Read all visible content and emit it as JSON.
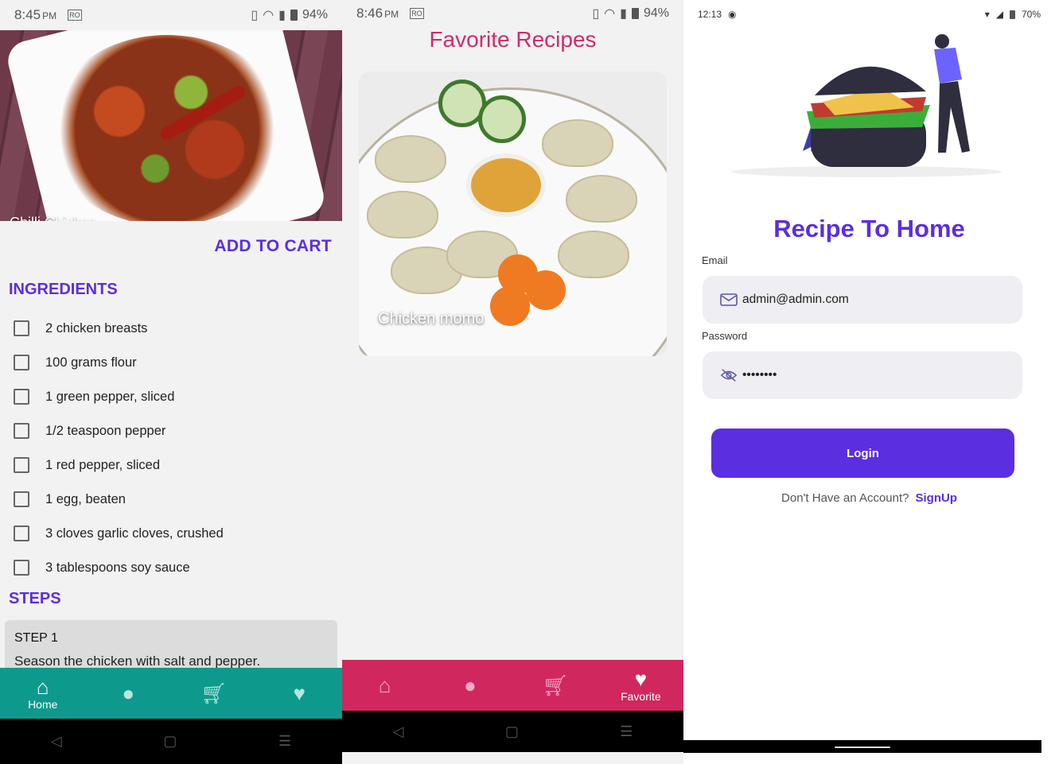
{
  "screen1": {
    "status": {
      "time": "8:45",
      "ampm": "PM",
      "badge": "RO",
      "battery": "94%"
    },
    "hero_title": "Chilli Chicken",
    "add_to_cart": "ADD TO CART",
    "ingredients_heading": "INGREDIENTS",
    "ingredients": [
      "2 chicken breasts",
      "100 grams flour",
      "1 green pepper, sliced",
      "1/2 teaspoon pepper",
      "1 red pepper, sliced",
      "1 egg, beaten",
      "3 cloves garlic cloves, crushed",
      "3 tablespoons soy sauce"
    ],
    "steps_heading": "STEPS",
    "step": {
      "title": "STEP 1",
      "text": "Season the chicken with salt and pepper."
    },
    "nav": {
      "home_label": "Home",
      "accent": "#0d9a8d"
    }
  },
  "screen2": {
    "status": {
      "time": "8:46",
      "ampm": "PM",
      "badge": "RO",
      "battery": "94%"
    },
    "title": "Favorite Recipes",
    "card_caption": "Chicken momo",
    "nav": {
      "favorite_label": "Favorite",
      "accent": "#d1275f"
    }
  },
  "screen3": {
    "status": {
      "time": "12:13",
      "battery": "70%"
    },
    "title": "Recipe To Home",
    "email_label": "Email",
    "email_value": "admin@admin.com",
    "password_label": "Password",
    "password_value": "••••••••",
    "login_label": "Login",
    "signup_prompt": "Don't Have an Account?",
    "signup_link": "SignUp",
    "accent": "#5b2ee0"
  },
  "icons": [
    "home-icon",
    "person-icon",
    "cart-icon",
    "heart-icon",
    "mail-icon",
    "eye-off-icon",
    "back-icon",
    "square-icon",
    "menu-icon"
  ]
}
